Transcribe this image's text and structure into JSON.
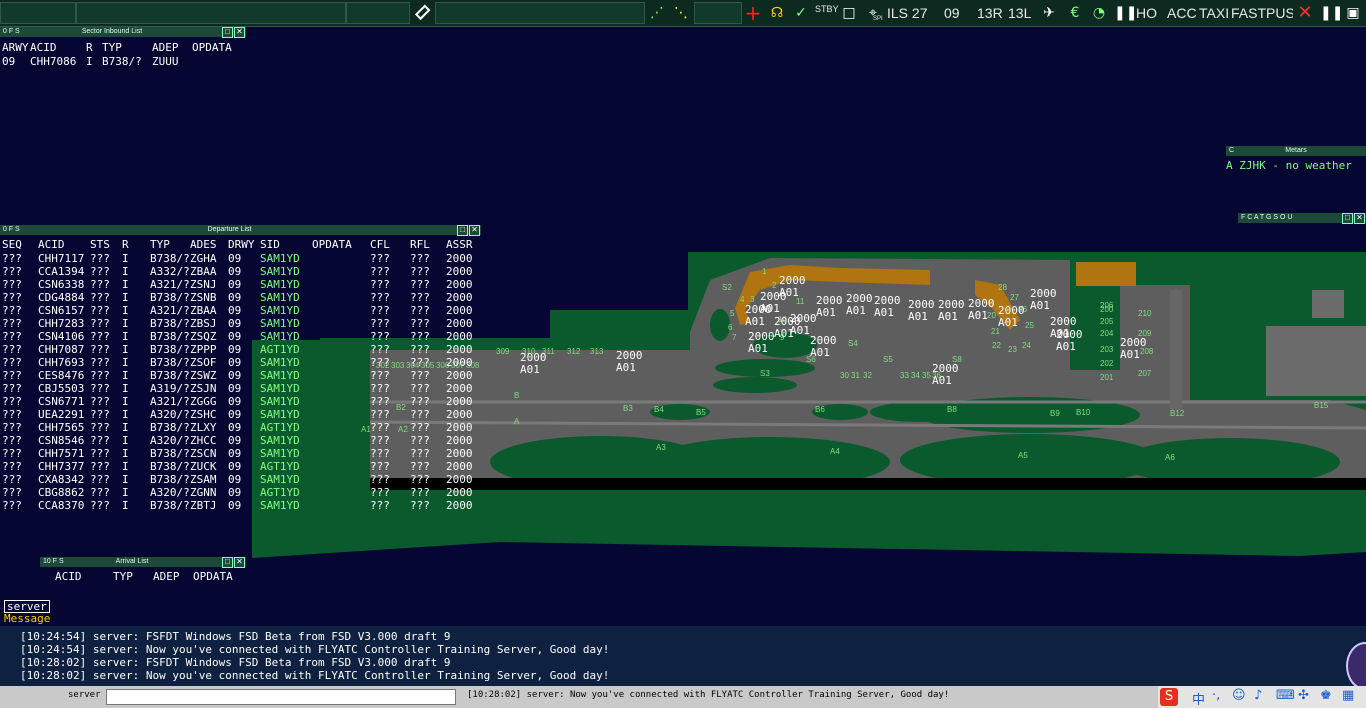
{
  "toolbar": {
    "ils": "ILS 27",
    "rwy": "09",
    "rwy_13r": "13R",
    "rwy_13l": "13L",
    "stby": "STBY",
    "ho": "HO",
    "acc": "ACC",
    "taxi": "TAXI",
    "fastpush": "FASTPUSH",
    "spi": "SPI"
  },
  "sector_inbound": {
    "title": "Sector Inbound List",
    "sys": "0  F  S",
    "headers": [
      "ARWY",
      "ACID",
      "R",
      "TYP",
      "ADEP",
      "OPDATA"
    ],
    "rows": [
      [
        "09",
        "CHH7086",
        "I",
        "B738/?",
        "ZUUU",
        ""
      ]
    ]
  },
  "metars": {
    "title": "Metars",
    "sys": "C",
    "text": "A ZJHK - no weather"
  },
  "filters": {
    "text": "F C A T G S O U"
  },
  "departure": {
    "title": "Departure List",
    "sys": "0  F  S",
    "headers": [
      "SEQ",
      "ACID",
      "STS",
      "R",
      "TYP",
      "ADES",
      "DRWY",
      "SID",
      "OPDATA",
      "CFL",
      "RFL",
      "ASSR"
    ],
    "rows": [
      [
        "???",
        "CHH7117",
        "???",
        "I",
        "B738/?",
        "ZGHA",
        "09",
        "SAM1YD",
        "",
        "???",
        "???",
        "2000"
      ],
      [
        "???",
        "CCA1394",
        "???",
        "I",
        "A332/?",
        "ZBAA",
        "09",
        "SAM1YD",
        "",
        "???",
        "???",
        "2000"
      ],
      [
        "???",
        "CSN6338",
        "???",
        "I",
        "A321/?",
        "ZSNJ",
        "09",
        "SAM1YD",
        "",
        "???",
        "???",
        "2000"
      ],
      [
        "???",
        "CDG4884",
        "???",
        "I",
        "B738/?",
        "ZSNB",
        "09",
        "SAM1YD",
        "",
        "???",
        "???",
        "2000"
      ],
      [
        "???",
        "CSN6157",
        "???",
        "I",
        "A321/?",
        "ZBAA",
        "09",
        "SAM1YD",
        "",
        "???",
        "???",
        "2000"
      ],
      [
        "???",
        "CHH7283",
        "???",
        "I",
        "B738/?",
        "ZBSJ",
        "09",
        "SAM1YD",
        "",
        "???",
        "???",
        "2000"
      ],
      [
        "???",
        "CSN4106",
        "???",
        "I",
        "B738/?",
        "ZSQZ",
        "09",
        "SAM1YD",
        "",
        "???",
        "???",
        "2000"
      ],
      [
        "???",
        "CHH7087",
        "???",
        "I",
        "B738/?",
        "ZPPP",
        "09",
        "AGT1YD",
        "",
        "???",
        "???",
        "2000"
      ],
      [
        "???",
        "CHH7693",
        "???",
        "I",
        "B738/?",
        "ZSOF",
        "09",
        "SAM1YD",
        "",
        "???",
        "???",
        "2000"
      ],
      [
        "???",
        "CES8476",
        "???",
        "I",
        "B738/?",
        "ZSWZ",
        "09",
        "SAM1YD",
        "",
        "???",
        "???",
        "2000"
      ],
      [
        "???",
        "CBJ5503",
        "???",
        "I",
        "A319/?",
        "ZSJN",
        "09",
        "SAM1YD",
        "",
        "???",
        "???",
        "2000"
      ],
      [
        "???",
        "CSN6771",
        "???",
        "I",
        "A321/?",
        "ZGGG",
        "09",
        "SAM1YD",
        "",
        "???",
        "???",
        "2000"
      ],
      [
        "???",
        "UEA2291",
        "???",
        "I",
        "A320/?",
        "ZSHC",
        "09",
        "SAM1YD",
        "",
        "???",
        "???",
        "2000"
      ],
      [
        "???",
        "CHH7565",
        "???",
        "I",
        "B738/?",
        "ZLXY",
        "09",
        "AGT1YD",
        "",
        "???",
        "???",
        "2000"
      ],
      [
        "???",
        "CSN8546",
        "???",
        "I",
        "A320/?",
        "ZHCC",
        "09",
        "SAM1YD",
        "",
        "???",
        "???",
        "2000"
      ],
      [
        "???",
        "CHH7571",
        "???",
        "I",
        "B738/?",
        "ZSCN",
        "09",
        "SAM1YD",
        "",
        "???",
        "???",
        "2000"
      ],
      [
        "???",
        "CHH7377",
        "???",
        "I",
        "B738/?",
        "ZUCK",
        "09",
        "AGT1YD",
        "",
        "???",
        "???",
        "2000"
      ],
      [
        "???",
        "CXA8342",
        "???",
        "I",
        "B738/?",
        "ZSAM",
        "09",
        "SAM1YD",
        "",
        "???",
        "???",
        "2000"
      ],
      [
        "???",
        "CBG8862",
        "???",
        "I",
        "A320/?",
        "ZGNN",
        "09",
        "AGT1YD",
        "",
        "???",
        "???",
        "2000"
      ],
      [
        "???",
        "CCA8370",
        "???",
        "I",
        "B738/?",
        "ZBTJ",
        "09",
        "SAM1YD",
        "",
        "???",
        "???",
        "2000"
      ]
    ]
  },
  "arrival": {
    "title": "Arrival List",
    "sys": "10  F  S",
    "headers": [
      "ACID",
      "TYP",
      "ADEP",
      "OPDATA"
    ]
  },
  "airport": {
    "stands": [
      "1",
      "2",
      "3",
      "4",
      "5",
      "6",
      "7",
      "9",
      "10",
      "11",
      "20",
      "21",
      "22",
      "23",
      "24",
      "25",
      "26",
      "27",
      "28",
      "30",
      "31",
      "32",
      "33",
      "34",
      "35",
      "36",
      "200",
      "201",
      "202",
      "203",
      "204",
      "205",
      "206",
      "207",
      "208",
      "209",
      "210",
      "302",
      "303",
      "304",
      "305",
      "306",
      "307",
      "308",
      "309",
      "310",
      "311",
      "312",
      "313",
      "S2",
      "S3",
      "S4",
      "S5",
      "S6",
      "S8"
    ],
    "taxiways": [
      "A",
      "A1",
      "A2",
      "A3",
      "A4",
      "A5",
      "A6",
      "B",
      "B2",
      "B3",
      "B4",
      "B5",
      "B6",
      "B8",
      "B9",
      "B10",
      "B12",
      "B15"
    ],
    "tags": [
      {
        "alt": "2000",
        "cs": "A01"
      },
      {
        "alt": "2000",
        "cs": "A01"
      },
      {
        "alt": "2000",
        "cs": "A01"
      },
      {
        "alt": "2000",
        "cs": "A01"
      },
      {
        "alt": "2000",
        "cs": "A01"
      },
      {
        "alt": "2000",
        "cs": "A01"
      },
      {
        "alt": "2000",
        "cs": "A01"
      },
      {
        "alt": "2000",
        "cs": "A01"
      },
      {
        "alt": "2000",
        "cs": "A01"
      },
      {
        "alt": "2000",
        "cs": "A01"
      },
      {
        "alt": "2000",
        "cs": "A01"
      },
      {
        "alt": "2000",
        "cs": "A01"
      },
      {
        "alt": "2000",
        "cs": "A01"
      },
      {
        "alt": "2000",
        "cs": "A01"
      },
      {
        "alt": "2000",
        "cs": "A01"
      },
      {
        "alt": "2000",
        "cs": "A01"
      },
      {
        "alt": "2000",
        "cs": "A01"
      },
      {
        "alt": "2000",
        "cs": "A01"
      },
      {
        "alt": "2000",
        "cs": "A01"
      },
      {
        "alt": "2000",
        "cs": "A01"
      },
      {
        "alt": "2000",
        "cs": "A01"
      }
    ]
  },
  "messages": {
    "tab": "server",
    "tab_label": "Message",
    "lines": [
      "[10:24:54] server: FSFDT Windows FSD Beta from FSD V3.000 draft 9",
      "[10:24:54] server: Now you've connected with FLYATC Controller Training Server, Good day!",
      "[10:28:02] server: FSFDT Windows FSD Beta from FSD V3.000 draft 9",
      "[10:28:02] server: Now you've connected with FLYATC Controller Training Server, Good day!"
    ]
  },
  "input_bar": {
    "label": "server",
    "value": "",
    "last_msg": "[10:28:02] server: Now you've connected with FLYATC Controller Training Server, Good day!"
  },
  "taskbar": {
    "ime": "中"
  }
}
